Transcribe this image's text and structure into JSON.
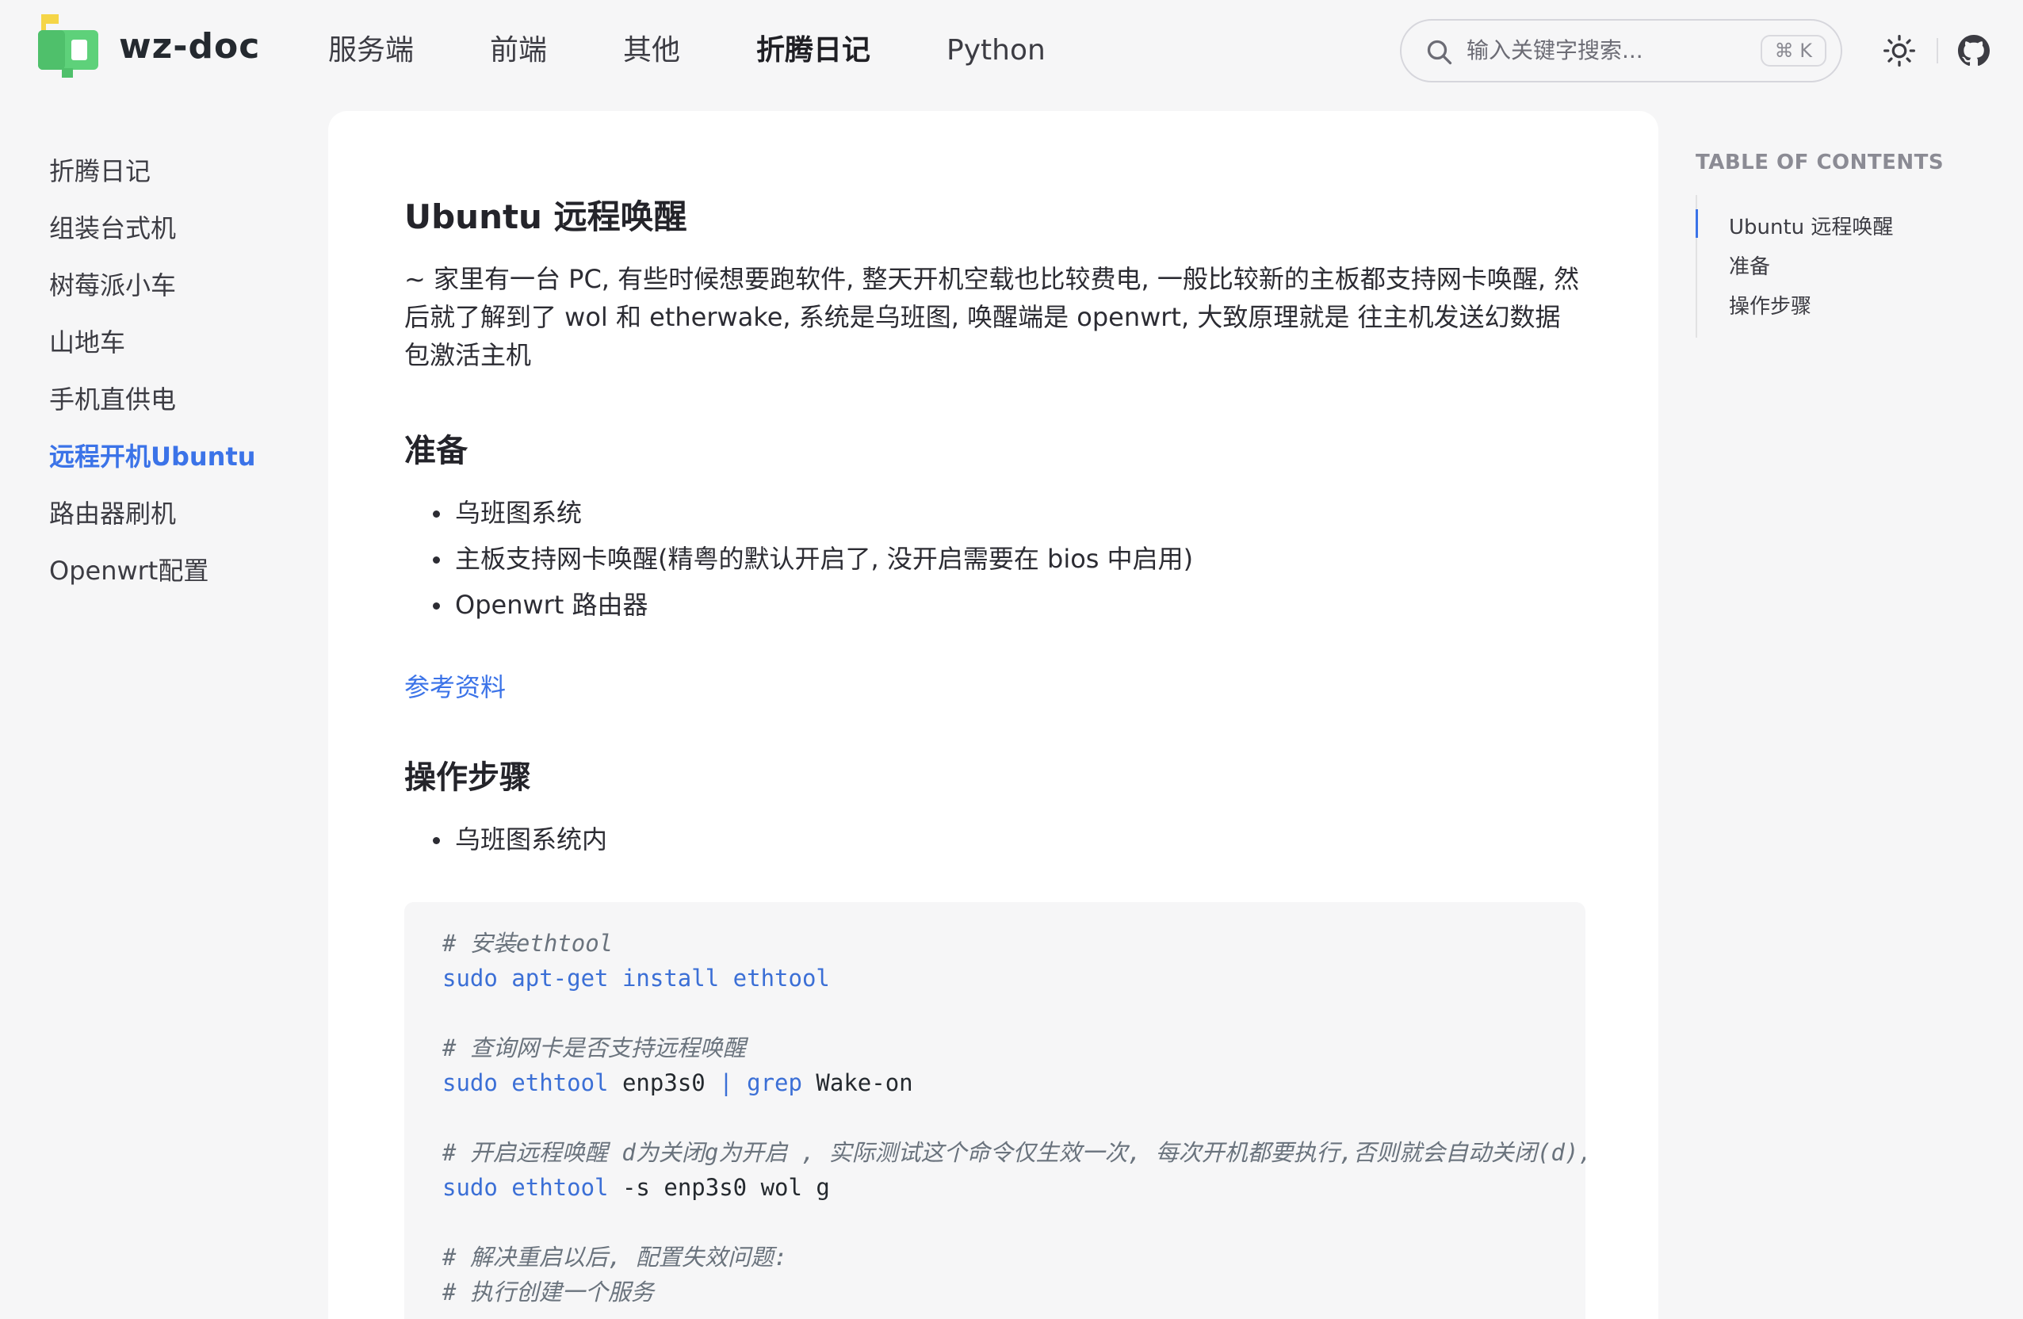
{
  "navbar": {
    "site_name": "wz-doc",
    "menu": [
      {
        "label": "服务端",
        "active": false
      },
      {
        "label": "前端",
        "active": false
      },
      {
        "label": "其他",
        "active": false
      },
      {
        "label": "折腾日记",
        "active": true
      },
      {
        "label": "Python",
        "active": false
      }
    ],
    "search": {
      "placeholder": "输入关键字搜索...",
      "shortcut": "⌘ K"
    },
    "icons": {
      "theme": "sun-icon",
      "repo": "github-icon",
      "search": "search-icon"
    }
  },
  "sidebar": {
    "items": [
      {
        "label": "折腾日记",
        "active": false
      },
      {
        "label": "组装台式机",
        "active": false
      },
      {
        "label": "树莓派小车",
        "active": false
      },
      {
        "label": "山地车",
        "active": false
      },
      {
        "label": "手机直供电",
        "active": false
      },
      {
        "label": "远程开机Ubuntu",
        "active": true
      },
      {
        "label": "路由器刷机",
        "active": false
      },
      {
        "label": "Openwrt配置",
        "active": false
      }
    ]
  },
  "article": {
    "title": "Ubuntu 远程唤醒",
    "intro": "~ 家里有一台 PC, 有些时候想要跑软件, 整天开机空载也比较费电, 一般比较新的主板都支持网卡唤醒, 然后就了解到了 wol 和 etherwake, 系统是乌班图, 唤醒端是 openwrt, 大致原理就是 往主机发送幻数据包激活主机",
    "prep_heading": "准备",
    "prep_items": [
      "乌班图系统",
      "主板支持网卡唤醒(精粤的默认开启了, 没开启需要在 bios 中启用)",
      "Openwrt 路由器"
    ],
    "reference_link": "参考资料",
    "steps_heading": "操作步骤",
    "steps_items": [
      "乌班图系统内"
    ],
    "code": [
      {
        "type": "comment",
        "text": "# 安装ethtool"
      },
      {
        "type": "code",
        "tokens": [
          {
            "t": "sudo apt-get install ethtool",
            "c": "cmd"
          }
        ]
      },
      {
        "type": "comment",
        "text": "# 查询网卡是否支持远程唤醒"
      },
      {
        "type": "code",
        "tokens": [
          {
            "t": "sudo ethtool",
            "c": "cmd"
          },
          {
            "t": " enp3s0 ",
            "c": "plain"
          },
          {
            "t": "| grep",
            "c": "cmd"
          },
          {
            "t": " Wake-on",
            "c": "plain"
          }
        ]
      },
      {
        "type": "comment",
        "text": "# 开启远程唤醒 d为关闭g为开启 , 实际测试这个命令仅生效一次, 每次开机都要执行,否则就会自动关闭(d),"
      },
      {
        "type": "code",
        "tokens": [
          {
            "t": "sudo ethtool",
            "c": "cmd"
          },
          {
            "t": " -s enp3s0 wol g",
            "c": "plain"
          }
        ]
      },
      {
        "type": "comment",
        "text": "# 解决重启以后, 配置失效问题:"
      },
      {
        "type": "comment",
        "text": "# 执行创建一个服务"
      }
    ]
  },
  "toc": {
    "title": "TABLE OF CONTENTS",
    "items": [
      {
        "label": "Ubuntu 远程唤醒",
        "active": true
      },
      {
        "label": "准备",
        "active": false
      },
      {
        "label": "操作步骤",
        "active": false
      }
    ]
  },
  "colors": {
    "accent": "#3b73e8",
    "logo_green": "#5ed17a",
    "logo_yellow": "#f5d547"
  }
}
